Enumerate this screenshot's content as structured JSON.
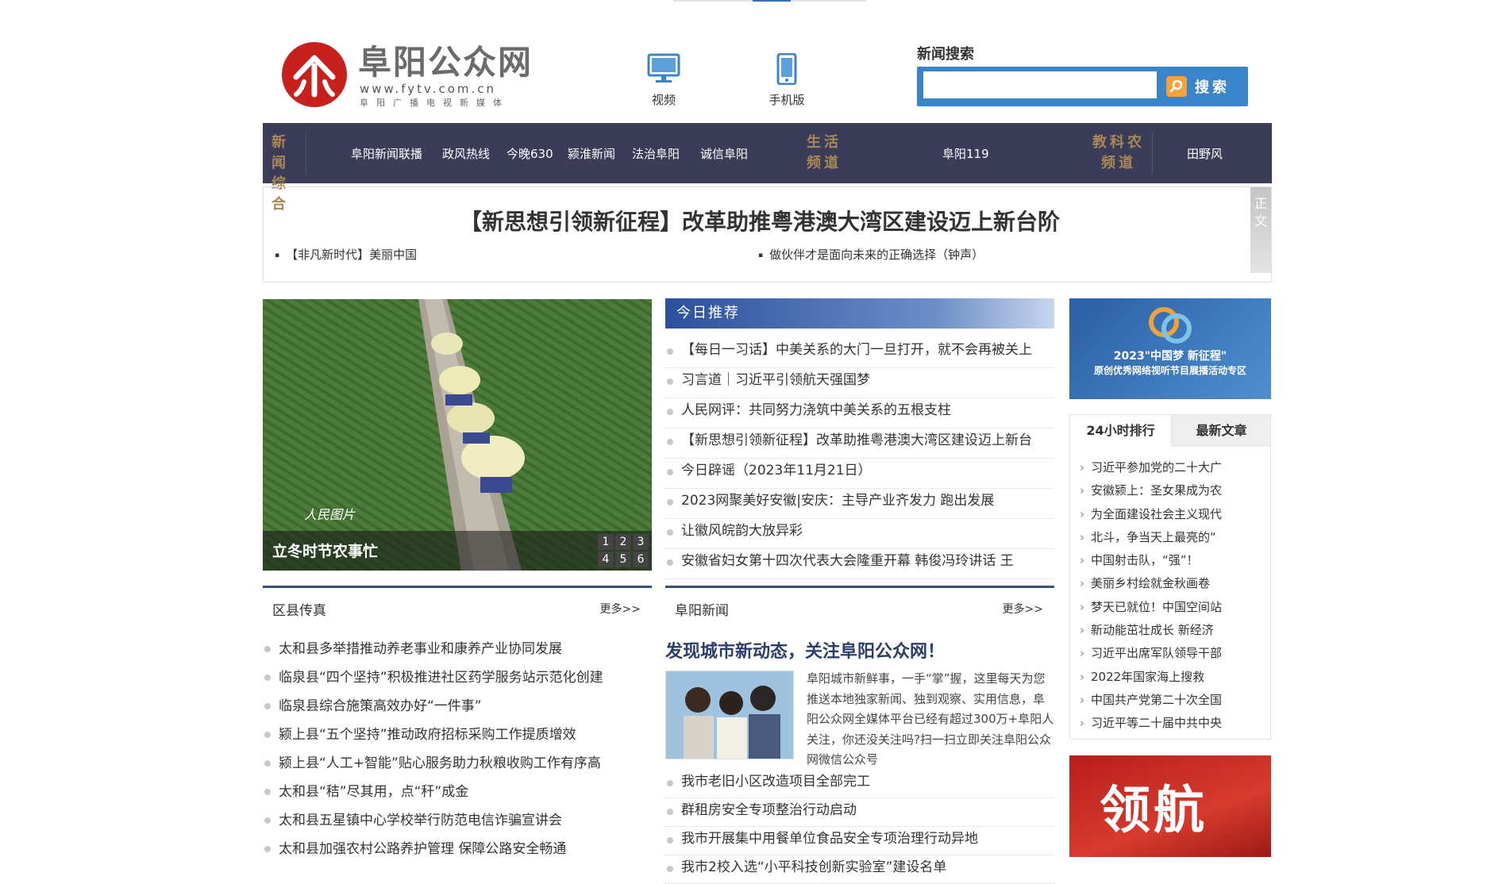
{
  "header": {
    "logo_name": "阜阳公众网",
    "logo_url": "www.fytv.com.cn",
    "logo_tagline": "阜阳广播电视新媒体",
    "video_label": "视频",
    "mobile_label": "手机版",
    "search_label": "新闻搜索",
    "search_placeholder": "",
    "search_button": "搜索"
  },
  "nav": {
    "cat1": "新闻综合",
    "cat1_items": [
      "阜阳新闻联播",
      "政风热线",
      "今晚630",
      "颍淮新闻",
      "法治阜阳",
      "诚信阜阳"
    ],
    "cat2": "生活频道",
    "cat2_items": [
      "阜阳119"
    ],
    "cat3": "教科农频道",
    "cat3_items": [
      "田野风"
    ]
  },
  "headline": {
    "title": "【新思想引领新征程】改革助推粤港澳大湾区建设迈上新台阶",
    "sub1": "【非凡新时代】美丽中国",
    "sub2": "做伙伴才是面向未来的正确选择（钟声）",
    "side_tab": "正文"
  },
  "slideshow": {
    "caption": "立冬时节农事忙",
    "watermark": "人民图片",
    "pages": [
      "1",
      "2",
      "3",
      "4",
      "5",
      "6"
    ]
  },
  "recommend": {
    "title": "今日推荐",
    "items": [
      "【每日一习话】中美关系的大门一旦打开，就不会再被关上",
      "习言道｜习近平引领航天强国梦",
      "人民网评：共同努力浇筑中美关系的五根支柱",
      "【新思想引领新征程】改革助推粤港澳大湾区建设迈上新台",
      "今日辟谣（2023年11月21日）",
      "2023网聚美好安徽|安庆：主导产业齐发力 跑出发展",
      "让徽风皖韵大放异彩",
      "安徽省妇女第十四次代表大会隆重开幕 韩俊冯玲讲话 王"
    ]
  },
  "promo": {
    "line1": "2023\"中国梦 新征程\"",
    "line2": "原创优秀网络视听节目展播活动专区"
  },
  "ranking": {
    "tab1": "24小时排行",
    "tab2": "最新文章",
    "items": [
      "习近平参加党的二十大广",
      "安徽颍上：圣女果成为农",
      "为全面建设社会主义现代",
      "北斗，争当天上最亮的“",
      "中国射击队，“强”！",
      "美丽乡村绘就金秋画卷",
      "梦天已就位！中国空间站",
      "新动能茁壮成长 新经济",
      "习近平出席军队领导干部",
      "2022年国家海上搜救",
      "中国共产党第二十次全国",
      "习近平等二十届中共中央"
    ]
  },
  "banner": {
    "text": "领航"
  },
  "county": {
    "title": "区县传真",
    "more": "更多>>",
    "items": [
      "太和县多举措推动养老事业和康养产业协同发展",
      "临泉县“四个坚持”积极推进社区药学服务站示范化创建",
      "临泉县综合施策高效办好“一件事”",
      "颍上县“五个坚持”推动政府招标采购工作提质增效",
      "颍上县“人工+智能”贴心服务助力秋粮收购工作有序高",
      "太和县“秸”尽其用，点“秆”成金",
      "太和县五星镇中心学校举行防范电信诈骗宣讲会",
      "太和县加强农村公路养护管理 保障公路安全畅通"
    ]
  },
  "city": {
    "title": "阜阳新闻",
    "more": "更多>>",
    "feature_title": "发现城市新动态，关注阜阳公众网！",
    "feature_desc": "阜阳城市新鲜事，一手“掌”握，这里每天为您推送本地独家新闻、独到观察、实用信息，阜阳公众网全媒体平台已经有超过300万+阜阳人关注，你还没关注吗?扫一扫立即关注阜阳公众网微信公众号",
    "items": [
      "我市老旧小区改造项目全部完工",
      "群租房安全专项整治行动启动",
      "我市开展集中用餐单位食品安全专项治理行动异地",
      "我市2校入选“小平科技创新实验室”建设名单"
    ]
  },
  "colors": {
    "nav_bg": "#3b3c57",
    "nav_category": "#a88856",
    "search_blue": "#3a84cc",
    "logo_red": "#c8211d"
  }
}
